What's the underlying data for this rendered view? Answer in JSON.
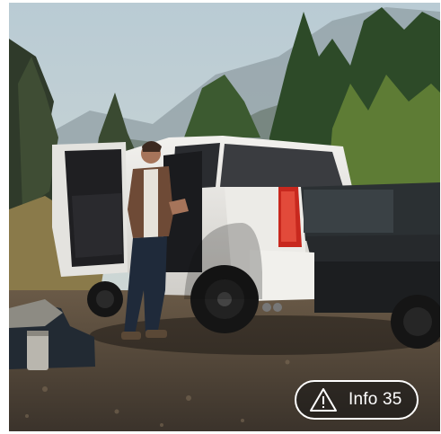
{
  "image": {
    "alt_subject": "pickup-truck-campsite-photo"
  },
  "badge": {
    "label": "Info 35",
    "icon": "warning-triangle-icon"
  },
  "colors": {
    "truck_body": "#e9e8e4",
    "badge_border": "#ffffff",
    "badge_text": "#ffffff"
  }
}
